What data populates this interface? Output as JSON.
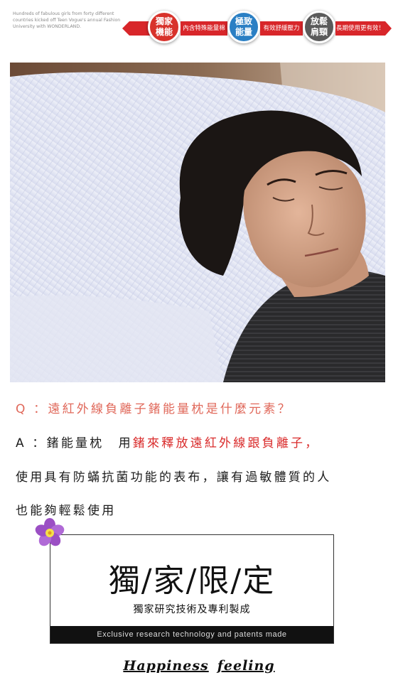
{
  "banner": {
    "tagline": "Hundreds of fabulous girls from forty different countries kicked off Teen Vogue's annual Fashion University with WONDERLAND.",
    "ribbon_texts": [
      "內含特殊能量棉",
      "有效舒緩壓力",
      "長期使用更有效！"
    ],
    "badges": [
      {
        "label": "獨家機能",
        "color": "#d8322b"
      },
      {
        "label": "極致能量",
        "color": "#2a7fc4"
      },
      {
        "label": "放鬆肩頸",
        "color": "#5a5a5a"
      }
    ],
    "ribbon_color": "#d8262a"
  },
  "photo": {
    "icon": "sleeping-woman-on-pillow-photo"
  },
  "qa": {
    "question": "Q ：遠紅外線負離子鍺能量枕是什麼元素？",
    "answer_prefix": "A ：鍺能量枕　用",
    "answer_highlight": "鍺來釋放遠紅外線跟負離子，",
    "answer_line2": "使用具有防蟎抗菌功能的表布，讓有過敏體質的人",
    "answer_line3": "也能夠輕鬆使用",
    "question_color": "#e0685a",
    "highlight_color": "#d92a2a"
  },
  "exclusive": {
    "title": "獨/家/限/定",
    "subtitle": "獨家研究技術及專利製成",
    "bar_text": "Exclusive research technology and patents made",
    "flower_icon": "purple-flower-icon"
  },
  "signature": {
    "word1": "Happiness",
    "word2": "feeling"
  }
}
